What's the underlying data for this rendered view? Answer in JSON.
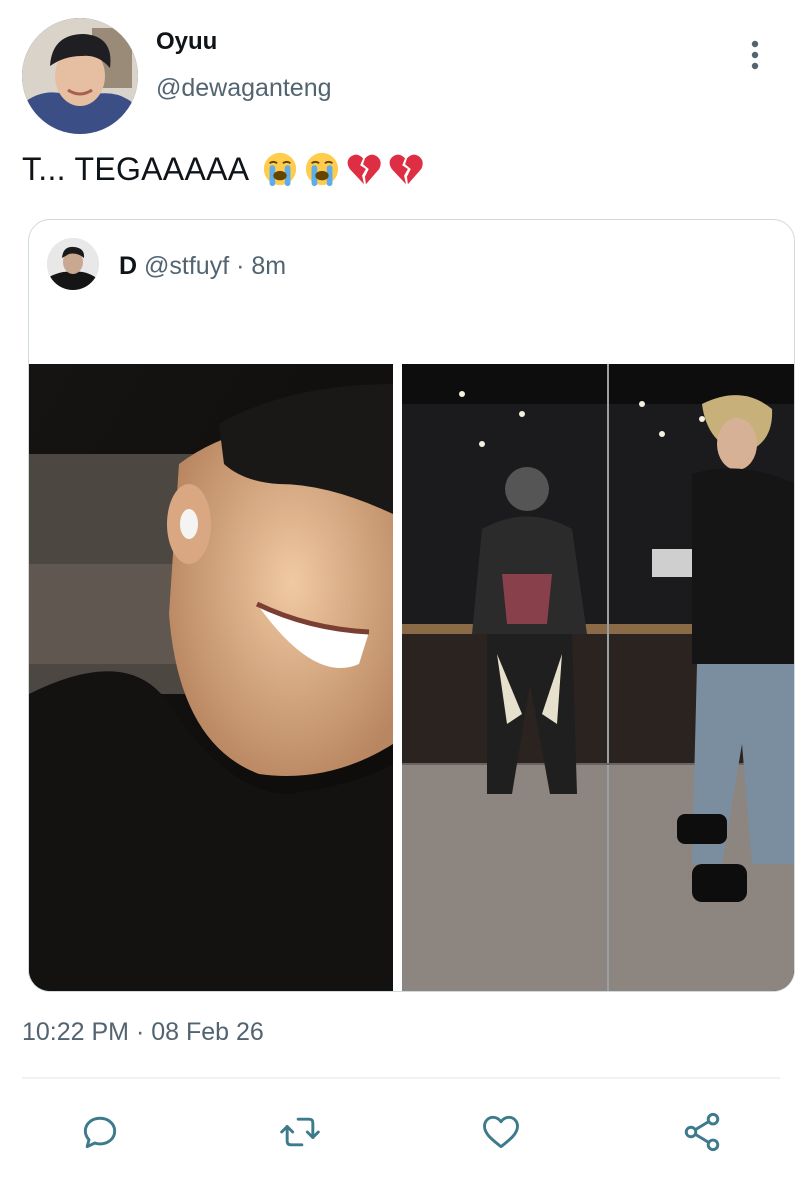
{
  "author": {
    "display_name": "Oyuu",
    "handle": "@dewaganteng"
  },
  "tweet": {
    "text": "T... TEGAAAAA",
    "emojis": [
      "loudly-crying-face",
      "loudly-crying-face",
      "broken-heart",
      "broken-heart"
    ],
    "timestamp": "10:22 PM · 08 Feb 26"
  },
  "quoted_tweet": {
    "display_name": "D",
    "handle": "@stfuyf",
    "separator": "·",
    "age": "8m",
    "media": [
      "selfie-photo",
      "elevator-mirror-photo"
    ]
  },
  "actions": {
    "reply_icon": "reply-icon",
    "retweet_icon": "retweet-icon",
    "like_icon": "like-icon",
    "share_icon": "share-icon"
  },
  "colors": {
    "text": "#0f1419",
    "secondary": "#536471",
    "border": "#cfd9de",
    "icon": "#3d7a8c"
  }
}
